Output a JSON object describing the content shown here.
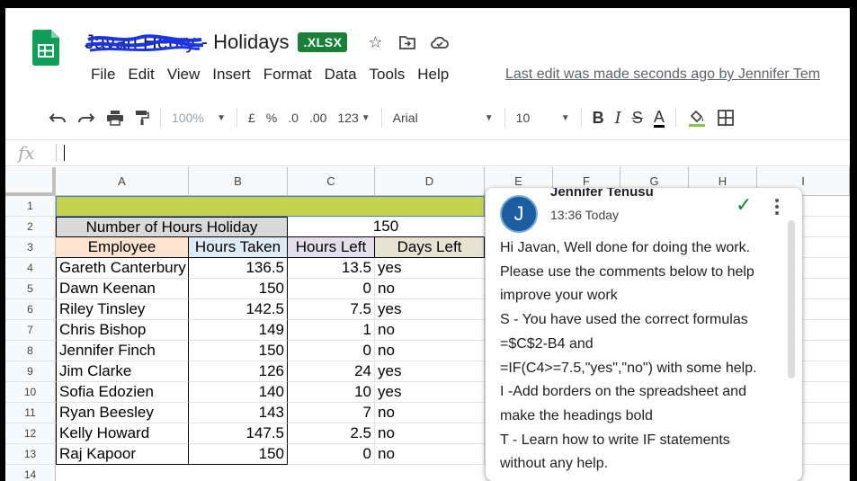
{
  "header": {
    "owner_name": "Javan Henry",
    "separator": " - ",
    "doc_title": "Holidays",
    "format_badge": ".XLSX",
    "icons": [
      "star-icon",
      "move-to-folder-icon",
      "cloud-status-icon"
    ]
  },
  "menu": [
    "File",
    "Edit",
    "View",
    "Insert",
    "Format",
    "Data",
    "Tools",
    "Help"
  ],
  "last_edit": "Last edit was made seconds ago by Jennifer Tem",
  "toolbar": {
    "zoom": "100%",
    "currency": "£",
    "percent": "%",
    "dec_decrease": ".0",
    "dec_increase": ".00",
    "more_formats": "123",
    "font": "Arial",
    "font_size": "10",
    "bold": "B",
    "italic": "I",
    "strike": "S",
    "text_color": "A"
  },
  "formula_bar": {
    "fx": "fx",
    "value": ""
  },
  "columns": [
    "A",
    "B",
    "C",
    "D",
    "E",
    "F",
    "G",
    "H",
    "I"
  ],
  "rows": [
    "1",
    "2",
    "3",
    "4",
    "5",
    "6",
    "7",
    "8",
    "9",
    "10",
    "11",
    "12",
    "13",
    "14"
  ],
  "sheet": {
    "summary_label": "Number of Hours Holiday",
    "summary_value": "150",
    "headers": {
      "employee": "Employee",
      "hours_taken": "Hours Taken",
      "hours_left": "Hours Left",
      "days_left": "Days Left"
    },
    "records": [
      {
        "name": "Gareth Canterbury",
        "taken": "136.5",
        "left": "13.5",
        "days": "yes"
      },
      {
        "name": "Dawn Keenan",
        "taken": "150",
        "left": "0",
        "days": "no"
      },
      {
        "name": "Riley Tinsley",
        "taken": "142.5",
        "left": "7.5",
        "days": "yes"
      },
      {
        "name": "Chris Bishop",
        "taken": "149",
        "left": "1",
        "days": "no"
      },
      {
        "name": "Jennifer Finch",
        "taken": "150",
        "left": "0",
        "days": "no"
      },
      {
        "name": "Jim Clarke",
        "taken": "126",
        "left": "24",
        "days": "yes"
      },
      {
        "name": "Sofia Edozien",
        "taken": "140",
        "left": "10",
        "days": "yes"
      },
      {
        "name": "Ryan Beesley",
        "taken": "143",
        "left": "7",
        "days": "no"
      },
      {
        "name": "Kelly Howard",
        "taken": "147.5",
        "left": "2.5",
        "days": "no"
      },
      {
        "name": "Raj Kapoor",
        "taken": "150",
        "left": "0",
        "days": "no"
      }
    ]
  },
  "comment": {
    "avatar_initial": "J",
    "author": "Jennifer Tenusu",
    "time": "13:36 Today",
    "lines": [
      "Hi Javan, Well done for doing the work.",
      "Please use the comments below to help",
      "improve your work",
      "S - You have used the correct formulas",
      "=$C$2-B4 and",
      "=IF(C4>=7.5,\"yes\",\"no\") with some help.",
      "I -Add borders on the spreadsheet and",
      "make the headings bold",
      "T - Learn how to write IF statements",
      "without any help."
    ]
  },
  "colors": {
    "row1_fill": "#c6d34e",
    "summary_fill": "#d9d9d9",
    "employee_fill": "#fde4d0",
    "hours_taken_fill": "#ddebf7",
    "hours_left_fill": "#e4dfec",
    "days_left_fill": "#e7e3d3",
    "badge_green": "#188038"
  }
}
